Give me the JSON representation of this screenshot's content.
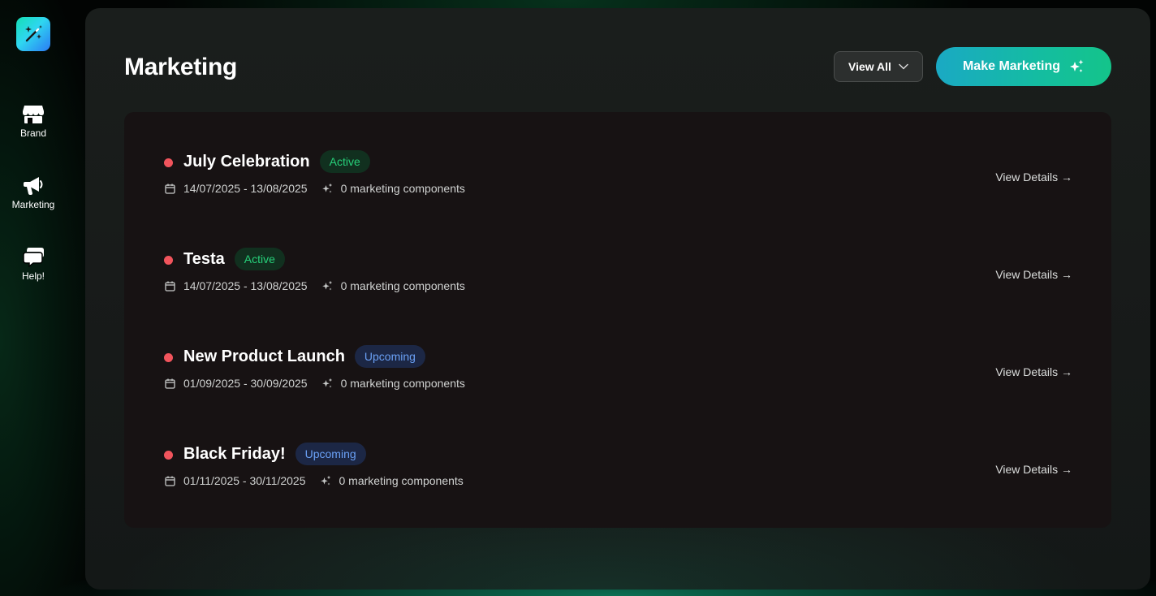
{
  "sidebar": {
    "logo_icon": "magic-wand-icon",
    "items": [
      {
        "label": "Brand",
        "icon": "store-icon"
      },
      {
        "label": "Marketing",
        "icon": "megaphone-icon"
      },
      {
        "label": "Help!",
        "icon": "chat-bubbles-icon"
      }
    ]
  },
  "header": {
    "title": "Marketing",
    "filter_label": "View All",
    "cta_label": "Make Marketing"
  },
  "campaigns": [
    {
      "name": "July Celebration",
      "status": "Active",
      "status_kind": "active",
      "dates": "14/07/2025 - 13/08/2025",
      "components": "0 marketing components",
      "action": "View Details →"
    },
    {
      "name": "Testa",
      "status": "Active",
      "status_kind": "active",
      "dates": "14/07/2025 - 13/08/2025",
      "components": "0 marketing components",
      "action": "View Details →"
    },
    {
      "name": "New Product Launch",
      "status": "Upcoming",
      "status_kind": "upcoming",
      "dates": "01/09/2025 - 30/09/2025",
      "components": "0 marketing components",
      "action": "View Details →"
    },
    {
      "name": "Black Friday!",
      "status": "Upcoming",
      "status_kind": "upcoming",
      "dates": "01/11/2025 - 30/11/2025",
      "components": "0 marketing components",
      "action": "View Details →"
    }
  ],
  "colors": {
    "accent_start": "#1aa9c4",
    "accent_end": "#14c48a",
    "active_text": "#27d17a",
    "upcoming_text": "#6aa0f5",
    "dot": "#f1545c"
  }
}
